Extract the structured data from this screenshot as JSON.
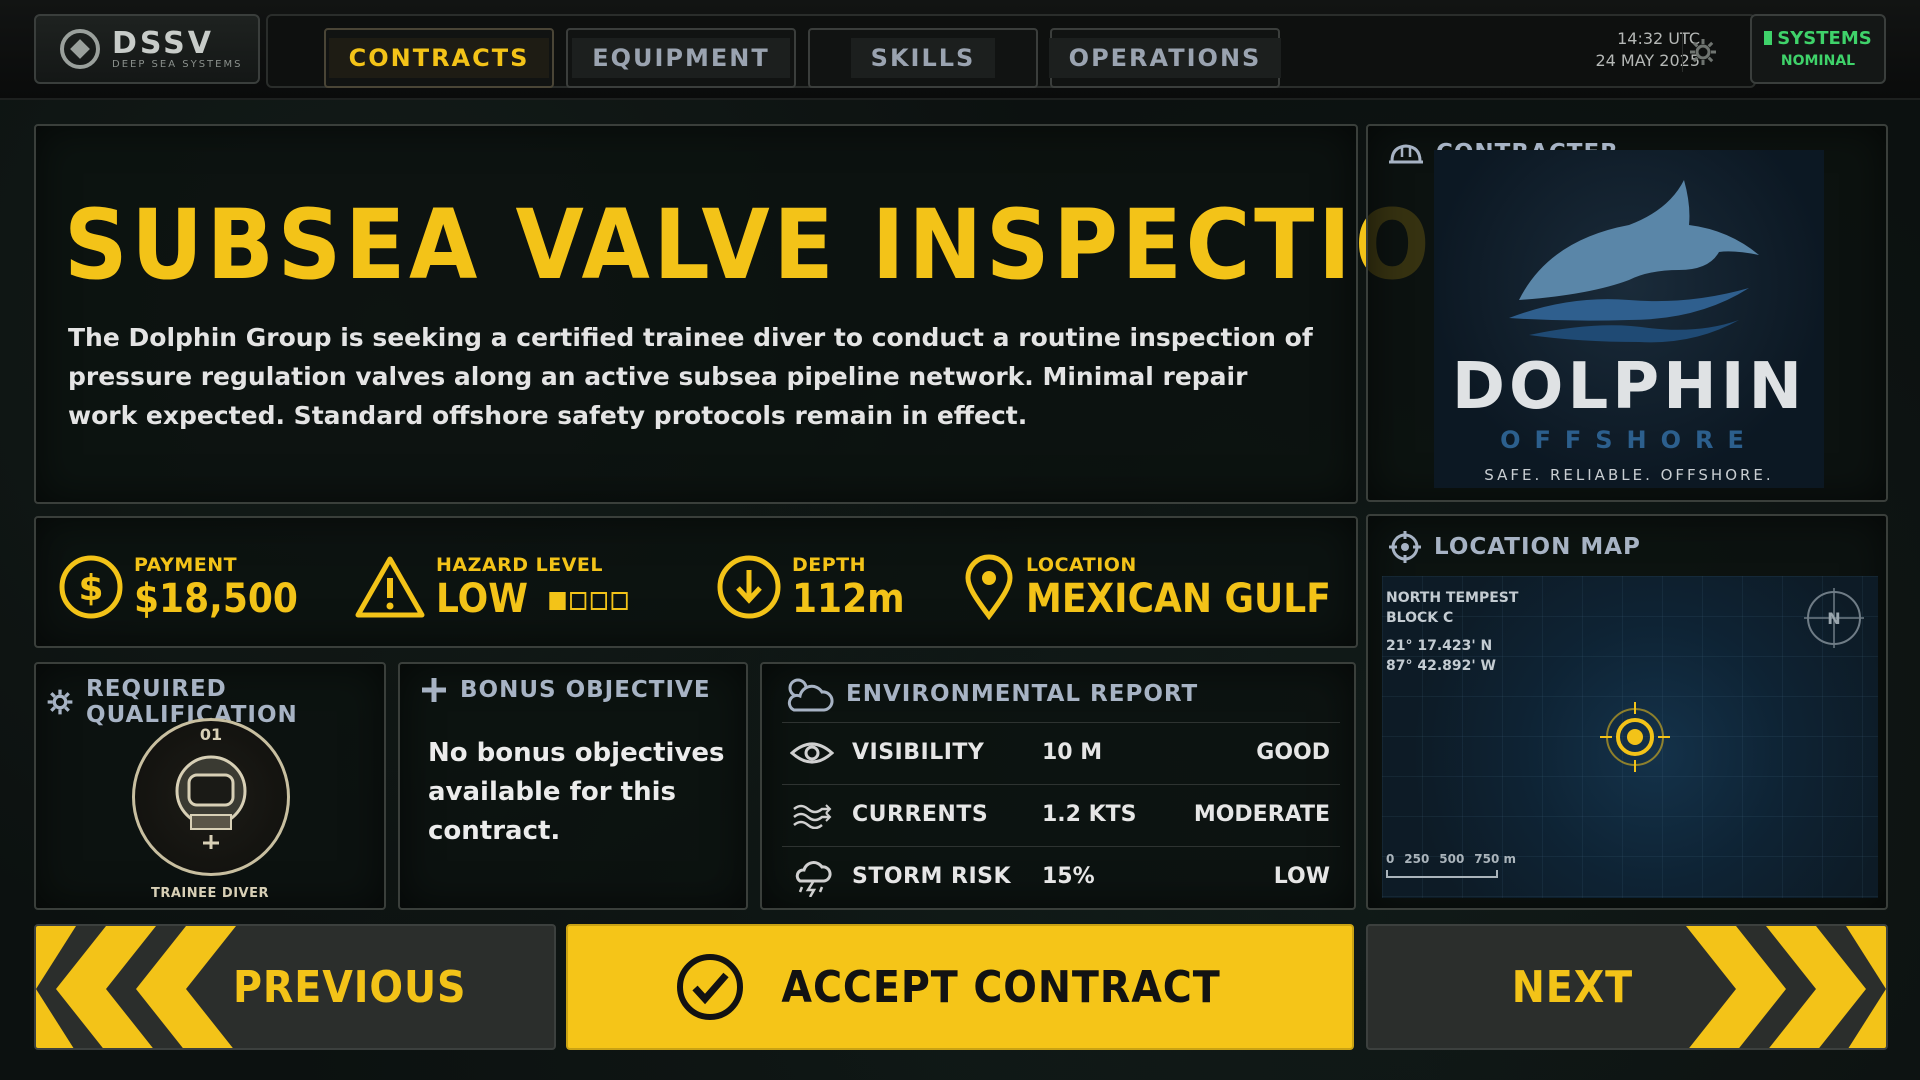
{
  "brand": {
    "name": "DSSV",
    "subtitle": "DEEP SEA SYSTEMS"
  },
  "nav": {
    "tabs": [
      {
        "label": "CONTRACTS",
        "active": true
      },
      {
        "label": "EQUIPMENT",
        "active": false
      },
      {
        "label": "SKILLS",
        "active": false
      },
      {
        "label": "OPERATIONS",
        "active": false
      }
    ]
  },
  "clock": {
    "time": "14:32 UTC",
    "date": "24 MAY 2025"
  },
  "systems": {
    "label": "SYSTEMS",
    "status": "NOMINAL"
  },
  "contract": {
    "title": "SUBSEA VALVE INSPECTION",
    "description": "The Dolphin Group is seeking a certified trainee diver to conduct a routine inspection of pressure regulation valves along an active subsea pipeline network. Minimal repair work expected. Standard offshore safety protocols remain in effect."
  },
  "contractor": {
    "heading": "CONTRACTER",
    "name": "DOLPHIN",
    "subname": "OFFSHORE",
    "slogan": "SAFE. RELIABLE. OFFSHORE."
  },
  "stats": {
    "payment": {
      "label": "PAYMENT",
      "value": "$18,500"
    },
    "hazard": {
      "label": "HAZARD LEVEL",
      "value": "LOW",
      "level": 1,
      "max": 4
    },
    "depth": {
      "label": "DEPTH",
      "value": "112m"
    },
    "location": {
      "label": "LOCATION",
      "value": "MEXICAN GULF"
    }
  },
  "map": {
    "heading": "LOCATION MAP",
    "area_line1": "NORTH TEMPEST",
    "area_line2": "BLOCK C",
    "lat": "21° 17.423' N",
    "lon": "87° 42.892' W",
    "compass": "N",
    "scale": [
      "0",
      "250",
      "500",
      "750 m"
    ]
  },
  "qualification": {
    "heading": "REQUIRED QUALIFICATION",
    "badge_number": "01",
    "badge_name": "TRAINEE DIVER"
  },
  "bonus": {
    "heading": "BONUS OBJECTIVE",
    "text": "No bonus objectives available for this contract."
  },
  "environment": {
    "heading": "ENVIRONMENTAL REPORT",
    "rows": [
      {
        "icon": "eye-icon",
        "name": "VISIBILITY",
        "value": "10 M",
        "rating": "GOOD"
      },
      {
        "icon": "currents-icon",
        "name": "CURRENTS",
        "value": "1.2 KTS",
        "rating": "MODERATE"
      },
      {
        "icon": "storm-icon",
        "name": "STORM RISK",
        "value": "15%",
        "rating": "LOW"
      }
    ]
  },
  "actions": {
    "previous": "PREVIOUS",
    "accept": "ACCEPT CONTRACT",
    "next": "NEXT"
  },
  "colors": {
    "accent": "#f3c318",
    "systems_ok": "#3fd26a",
    "panel_title": "#a7b3c4"
  }
}
